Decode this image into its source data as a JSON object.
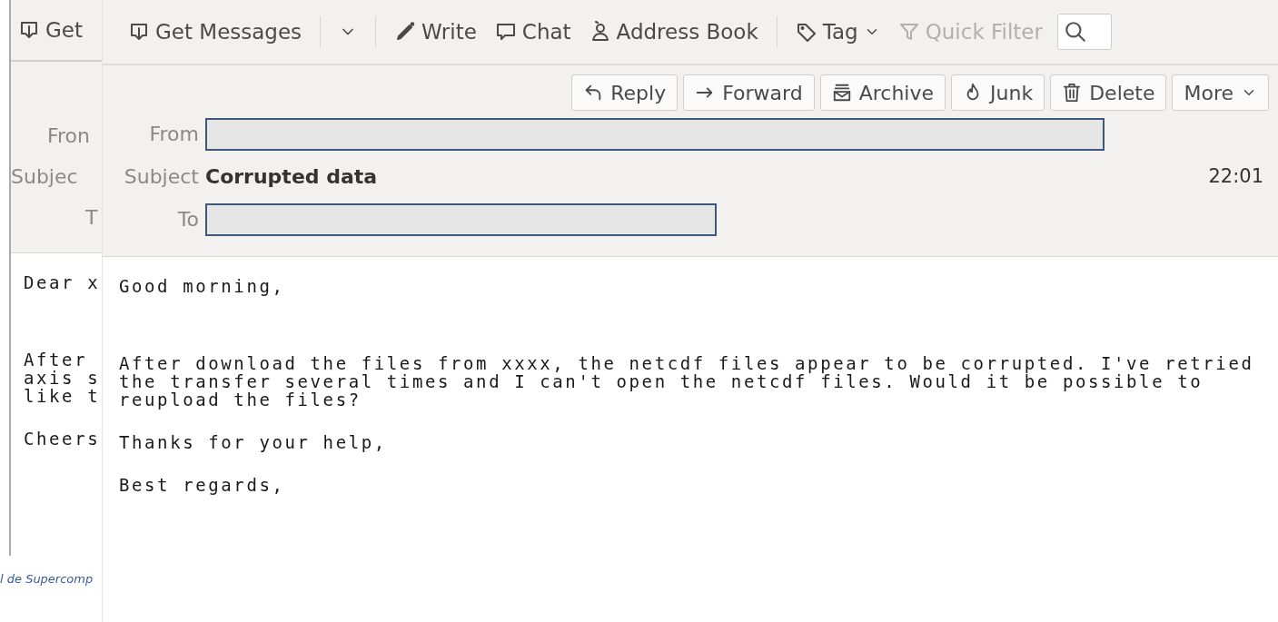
{
  "back_window": {
    "toolbar": [
      {
        "label": "Get"
      }
    ],
    "header_labels": [
      "Fron",
      "Subjec",
      "T"
    ],
    "body": [
      [
        "Dear x"
      ],
      [
        "After",
        "axis s",
        "like t"
      ],
      [
        "Cheers"
      ]
    ],
    "footer": "l de Supercomp"
  },
  "toolbar": [
    {
      "kind": "split",
      "label": "Get Messages",
      "disabled": false
    },
    {
      "kind": "button",
      "label": "Write",
      "disabled": false
    },
    {
      "kind": "button",
      "label": "Chat",
      "disabled": false
    },
    {
      "kind": "button",
      "label": "Address Book",
      "disabled": false
    },
    {
      "kind": "menu",
      "label": "Tag",
      "disabled": false
    },
    {
      "kind": "button",
      "label": "Quick Filter",
      "disabled": true
    }
  ],
  "actions": [
    {
      "kind": "button",
      "label": "Reply"
    },
    {
      "kind": "button",
      "label": "Forward"
    },
    {
      "kind": "button",
      "label": "Archive"
    },
    {
      "kind": "button",
      "label": "Junk"
    },
    {
      "kind": "button",
      "label": "Delete"
    },
    {
      "kind": "menu",
      "label": "More"
    }
  ],
  "header": [
    {
      "kind": "redacted",
      "label": "From"
    },
    {
      "kind": "text",
      "label": "Subject",
      "value": "Corrupted data",
      "time": "22:01"
    },
    {
      "kind": "redacted",
      "label": "To"
    }
  ],
  "body": [
    [
      "Good morning,"
    ],
    [
      "After download the files from xxxx, the netcdf files appear to be corrupted. I've retried",
      "the transfer several times and I can't open the netcdf files. Would it be possible to",
      "reupload the files?"
    ],
    [
      "Thanks for your help,"
    ],
    [
      "Best regards,"
    ]
  ]
}
